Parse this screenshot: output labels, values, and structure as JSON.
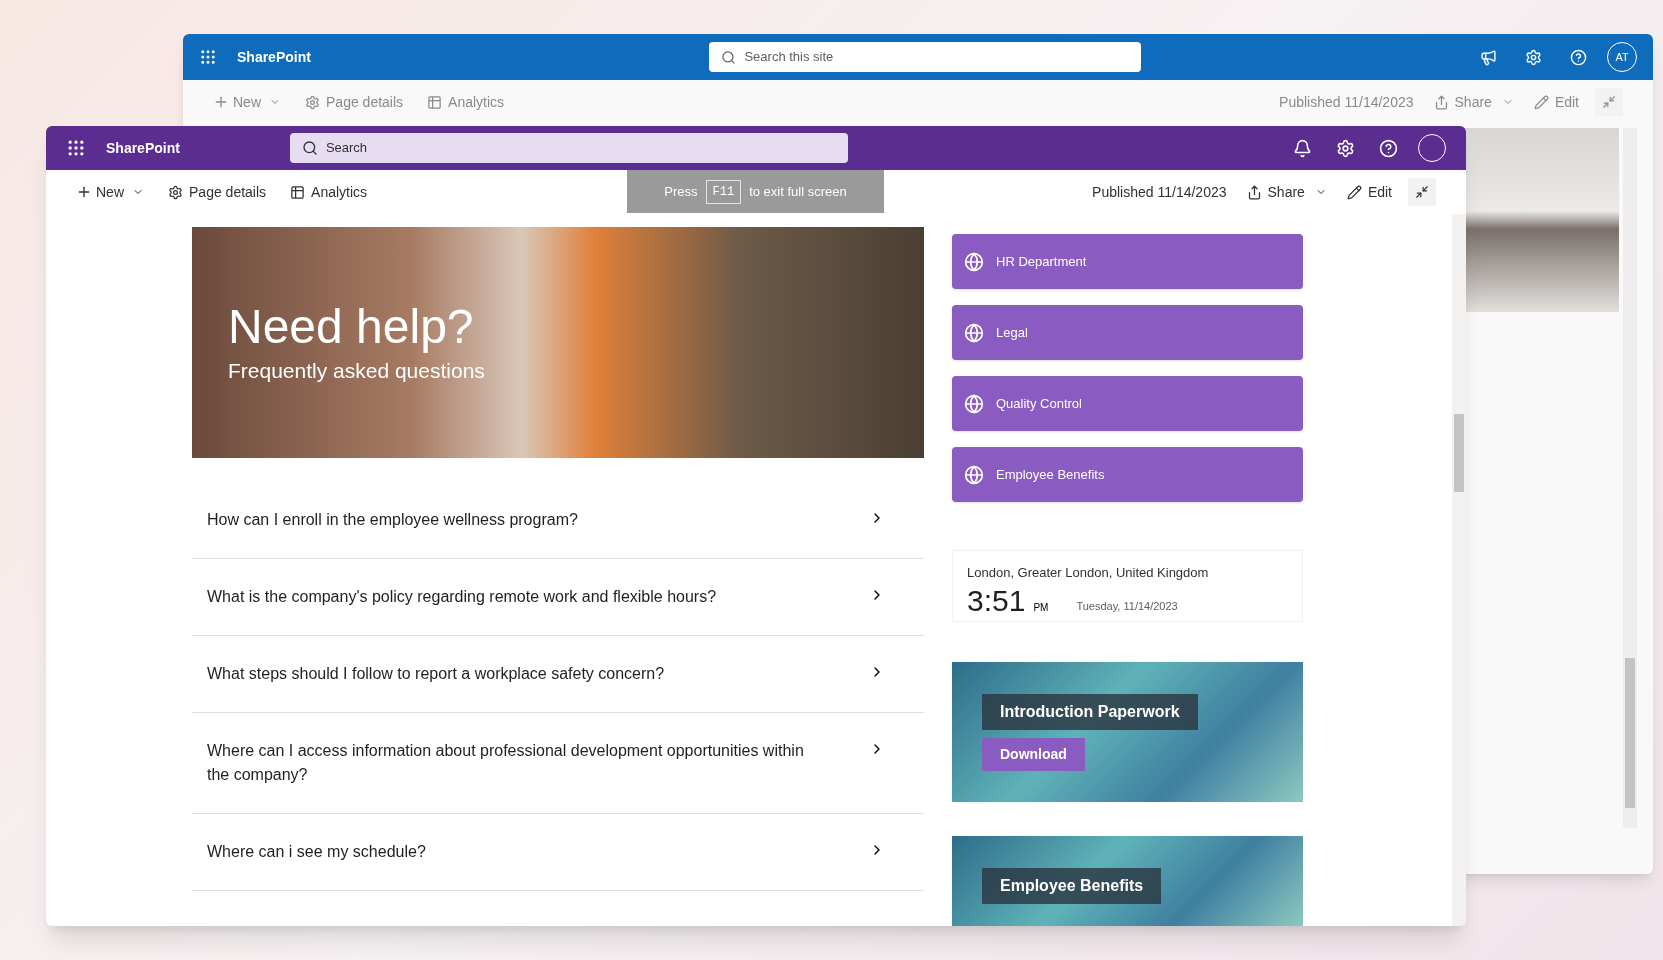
{
  "back_window": {
    "app_name": "SharePoint",
    "search_placeholder": "Search this site",
    "avatar_initials": "AT",
    "toolbar": {
      "new": "New",
      "page_details": "Page details",
      "analytics": "Analytics",
      "published": "Published 11/14/2023",
      "share": "Share",
      "edit": "Edit"
    }
  },
  "front_window": {
    "app_name": "SharePoint",
    "search_placeholder": "Search",
    "toolbar": {
      "new": "New",
      "page_details": "Page details",
      "analytics": "Analytics",
      "published": "Published 11/14/2023",
      "share": "Share",
      "edit": "Edit"
    },
    "fullscreen_hint": {
      "before": "Press",
      "key": "F11",
      "after": "to exit full screen"
    },
    "hero": {
      "title": "Need help?",
      "subtitle": "Frequently asked questions"
    },
    "faqs": [
      {
        "question": "How can I enroll in the employee wellness program?",
        "expanded": false
      },
      {
        "question": "What is the company's policy regarding remote work and flexible hours?",
        "expanded": false
      },
      {
        "question": "What steps should I follow to report a workplace safety concern?",
        "expanded": false
      },
      {
        "question": "Where can I access information about professional development opportunities within the company?",
        "expanded": false
      },
      {
        "question": "Where can i see my schedule?",
        "expanded": false
      }
    ],
    "quick_links": [
      {
        "label": "HR Department"
      },
      {
        "label": "Legal"
      },
      {
        "label": "Quality Control"
      },
      {
        "label": "Employee Benefits"
      }
    ],
    "clock": {
      "location": "London, Greater London, United Kingdom",
      "time": "3:51",
      "period": "PM",
      "date": "Tuesday, 11/14/2023"
    },
    "cards": [
      {
        "kind": "download",
        "title": "Introduction Paperwork",
        "button": "Download"
      },
      {
        "kind": "plain",
        "title": "Employee Benefits"
      }
    ]
  }
}
